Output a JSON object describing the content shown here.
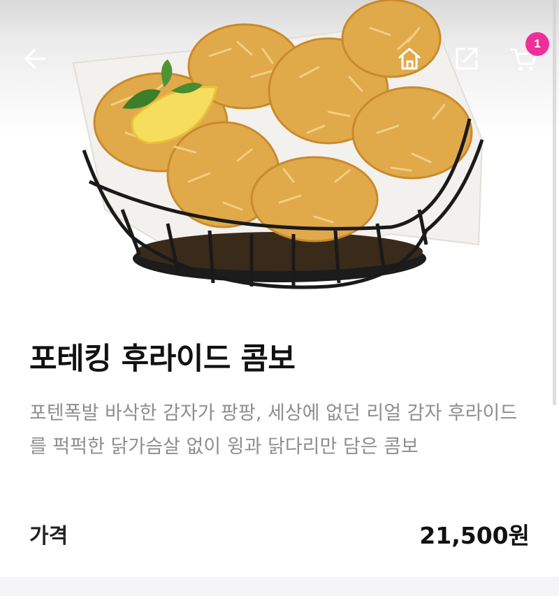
{
  "header": {
    "back_icon": "arrow-left-icon",
    "home_icon": "home-icon",
    "share_icon": "share-icon",
    "cart_icon": "cart-icon",
    "cart_count": "1",
    "badge_color": "#ee2f9a"
  },
  "product": {
    "image_alt": "",
    "name": "포테킹 후라이드 콤보",
    "description": "포텐폭발 바삭한 감자가 팡팡, 세상에 없던 리얼 감자 후라이드를 퍽퍽한 닭가슴살 없이 윙과 닭다리만 담은 콤보",
    "price_label": "가격",
    "price_value": "21,500원"
  }
}
